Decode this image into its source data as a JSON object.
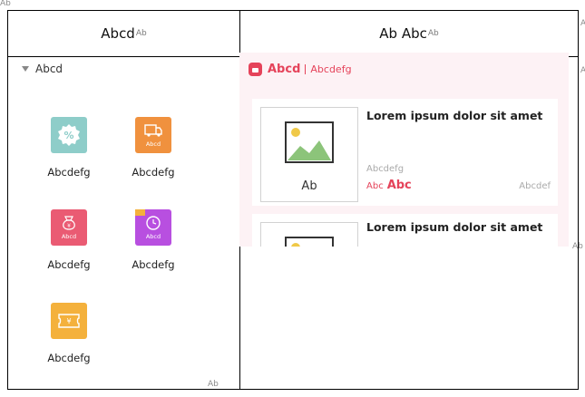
{
  "doc": {
    "corner_mark": "Ab",
    "return_mark": "Ab",
    "row_end_mark": "Ab"
  },
  "table": {
    "head_left": "Abcd",
    "head_right": "Ab Abc"
  },
  "left_panel": {
    "group_title": "Abcd",
    "components": [
      {
        "label": "Abcdefg",
        "icon": "percent-badge-icon",
        "color": "#8ecdc9",
        "caption": ""
      },
      {
        "label": "Abcdefg",
        "icon": "truck-clearance-icon",
        "color": "#f0913e",
        "caption": "Abcd"
      },
      {
        "label": "Abcdefg",
        "icon": "money-bag-icon",
        "color": "#ea5b73",
        "caption": "Abcd"
      },
      {
        "label": "Abcdefg",
        "icon": "alarm-clock-icon",
        "color": "#b84fe0",
        "caption": "Abcd"
      },
      {
        "label": "Abcdefg",
        "icon": "coupon-icon",
        "color": "#f4b13c",
        "caption": ""
      }
    ]
  },
  "preview": {
    "brand_title": "Abcd",
    "brand_sub": "Abcdefg",
    "accent": "#e5435a",
    "cards": [
      {
        "product_name": "Lorem ipsum dolor sit amet",
        "image_caption": "Ab",
        "ref_price": "Abcdefg",
        "price_label": "Abc",
        "price": "Abc",
        "sold": "Abcdef"
      },
      {
        "product_name": "Lorem ipsum dolor sit amet"
      }
    ]
  }
}
